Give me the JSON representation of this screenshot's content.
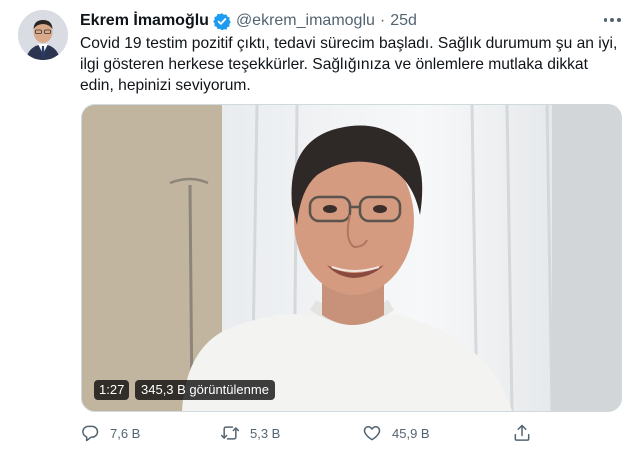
{
  "tweet": {
    "author_name": "Ekrem İmamoğlu",
    "handle": "@ekrem_imamoglu",
    "separator": "·",
    "time": "25d",
    "text": "Covid 19 testim pozitif çıktı, tedavi sürecim başladı. Sağlık durumum şu an iyi, ilgi gösteren herkese teşekkürler. Sağlığınıza ve önlemlere mutlaka dikkat edin, hepinizi seviyorum.",
    "video": {
      "duration": "1:27",
      "views": "345,3 B görüntülenme"
    },
    "actions": {
      "reply_count": "7,6 B",
      "retweet_count": "5,3 B",
      "like_count": "45,9 B"
    }
  },
  "colors": {
    "text": "#0f1419",
    "secondary": "#536471",
    "verified": "#1d9bf0"
  },
  "icons": [
    "verified-badge-icon",
    "more-options-icon",
    "reply-icon",
    "retweet-icon",
    "like-icon",
    "share-icon"
  ]
}
